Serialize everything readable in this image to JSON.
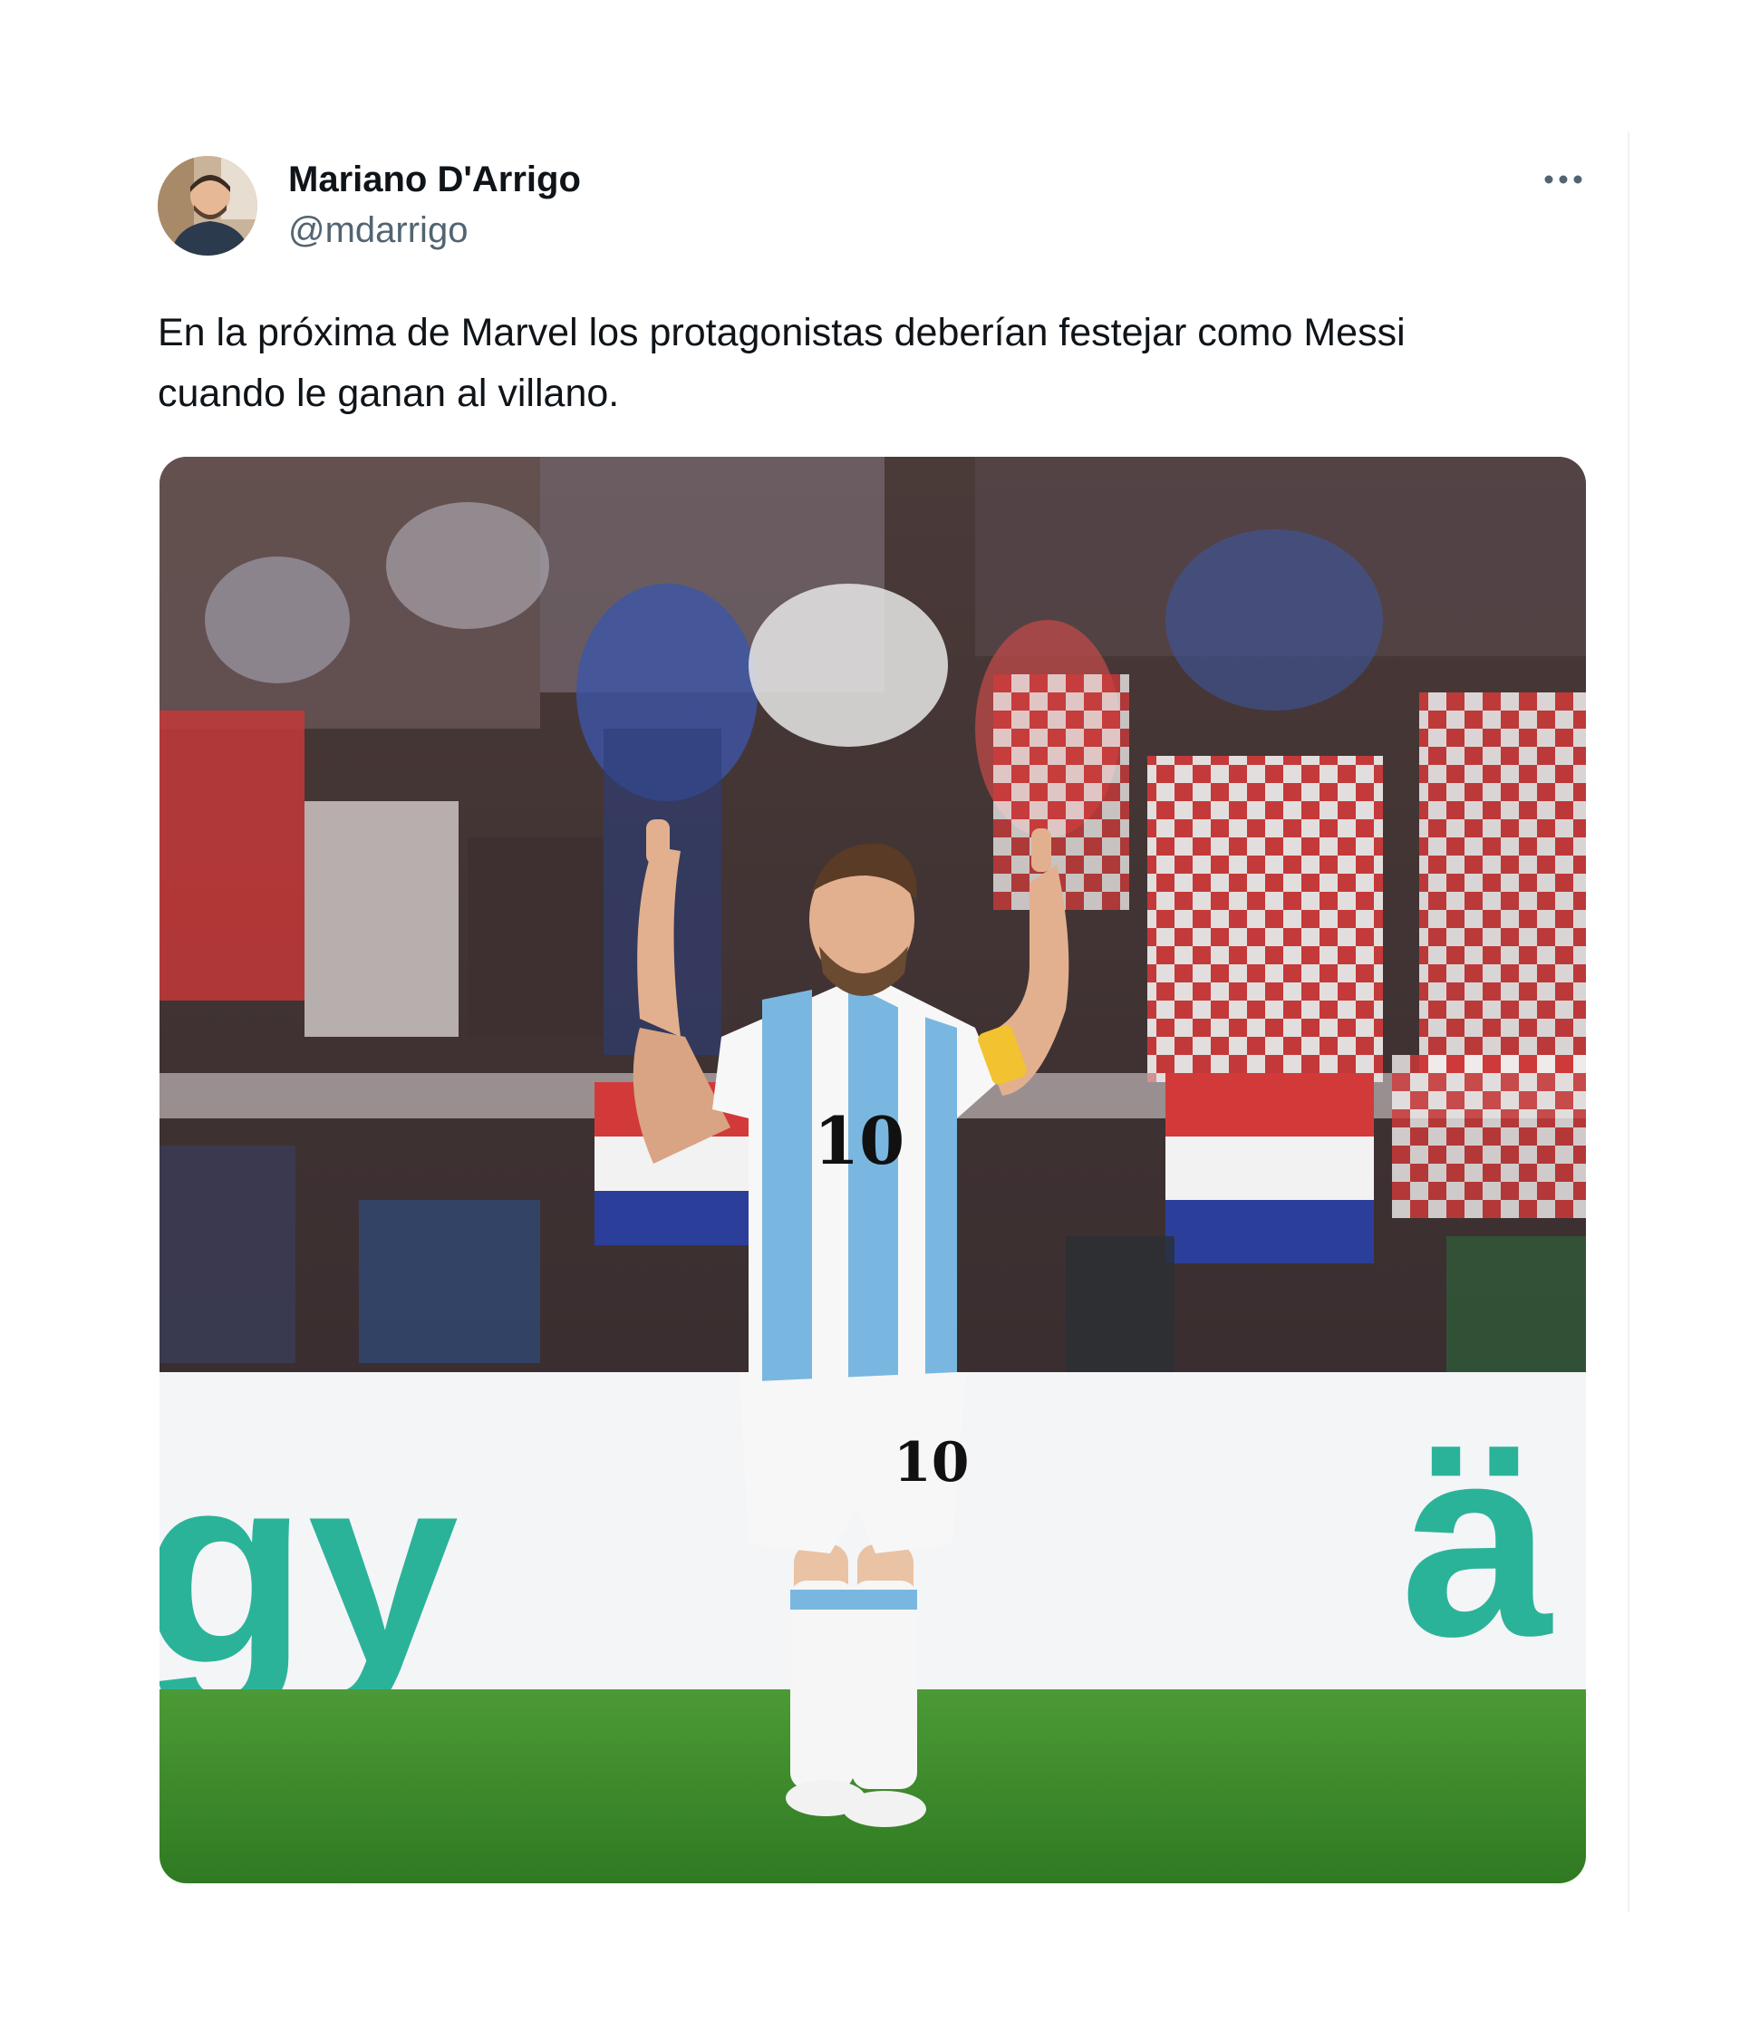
{
  "tweet": {
    "author": {
      "name": "Mariano D'Arrigo",
      "handle": "@mdarrigo"
    },
    "text": "En la próxima de Marvel los protagonistas deberían festejar como Messi\ncuando le ganan al villano.",
    "media": {
      "player_number": "10",
      "board_text_left": "gy",
      "board_text_right": "ä"
    }
  },
  "colors": {
    "name": "#0f1419",
    "handle": "#536471",
    "divider": "#eff3f4",
    "pitch": "#3f8a2e",
    "board_text": "#2bb39a",
    "shirt_blue": "#79b7e0"
  },
  "icons": {
    "more": "more-horizontal-icon"
  }
}
